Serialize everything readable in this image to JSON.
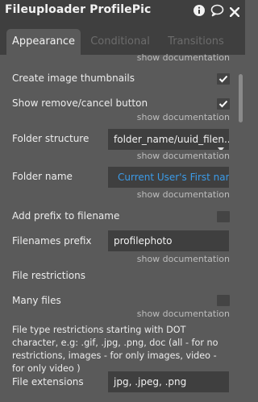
{
  "header": {
    "title": "Fileuploader ProfilePic",
    "icons": [
      "info-icon",
      "comment-icon",
      "close-icon"
    ]
  },
  "tabs": [
    {
      "label": "Appearance",
      "active": true
    },
    {
      "label": "Conditional",
      "active": false
    },
    {
      "label": "Transitions",
      "active": false
    }
  ],
  "show_documentation": "show documentation",
  "fields": {
    "create_thumbnails": {
      "label": "Create image thumbnails",
      "checked": true
    },
    "show_remove_cancel": {
      "label": "Show remove/cancel button",
      "checked": true
    },
    "folder_structure": {
      "label": "Folder structure",
      "value": "folder_name/uuid_filen..."
    },
    "folder_name": {
      "label": "Folder name",
      "value": "Current User's First name"
    },
    "add_prefix": {
      "label": "Add prefix to filename",
      "checked": false
    },
    "filenames_prefix": {
      "label": "Filenames prefix",
      "value": "profilephoto"
    },
    "file_restrictions": {
      "label": "File restrictions"
    },
    "many_files": {
      "label": "Many files",
      "checked": false
    },
    "type_restrictions_desc": "File type restrictions starting with DOT character, e.g: .gif, .jpg, .png, doc (all - for no restrictions, images - for only images, video - for only video )",
    "file_extensions": {
      "label": "File extensions",
      "value": "jpg, .jpeg, .png"
    }
  },
  "colors": {
    "background": "#5a5a5a",
    "header": "#3f3f3f",
    "input_bg": "#3f3f3f",
    "link_blue": "#3b9be8",
    "text": "#ececec"
  }
}
